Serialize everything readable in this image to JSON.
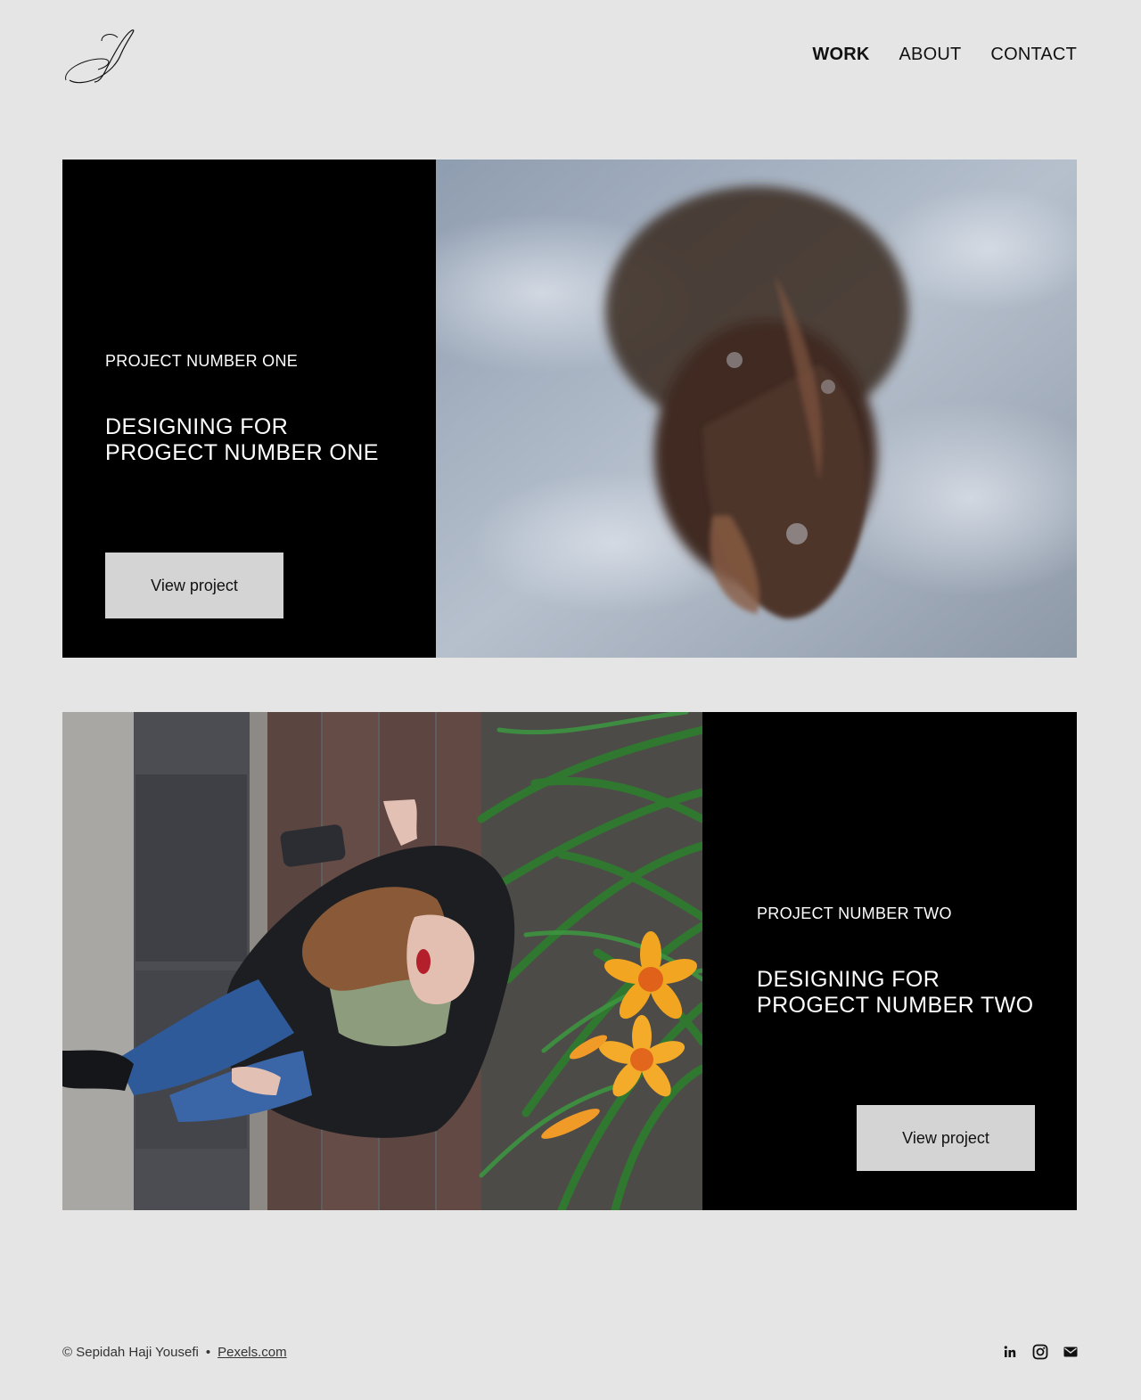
{
  "nav": {
    "items": [
      {
        "label": "WORK",
        "active": true
      },
      {
        "label": "ABOUT",
        "active": false
      },
      {
        "label": "CONTACT",
        "active": false
      }
    ]
  },
  "logo": {
    "icon": "script-s-logo-icon"
  },
  "projects": [
    {
      "kicker": "PROJECT NUMBER ONE",
      "headline_line1": "DESIGNING FOR",
      "headline_line2": "PROGECT NUMBER ONE",
      "button_label": "View project"
    },
    {
      "kicker": "PROJECT NUMBER TWO",
      "headline_line1": "DESIGNING FOR",
      "headline_line2": "PROGECT NUMBER TWO",
      "button_label": "View project"
    }
  ],
  "footer": {
    "copyright": "© Sepidah Haji Yousefi",
    "separator": "•",
    "link_label": "Pexels.com",
    "icons": [
      "linkedin-icon",
      "instagram-icon",
      "mail-icon"
    ]
  },
  "colors": {
    "background": "#e5e5e6",
    "panel": "#000000",
    "button": "#d4d4d5"
  }
}
